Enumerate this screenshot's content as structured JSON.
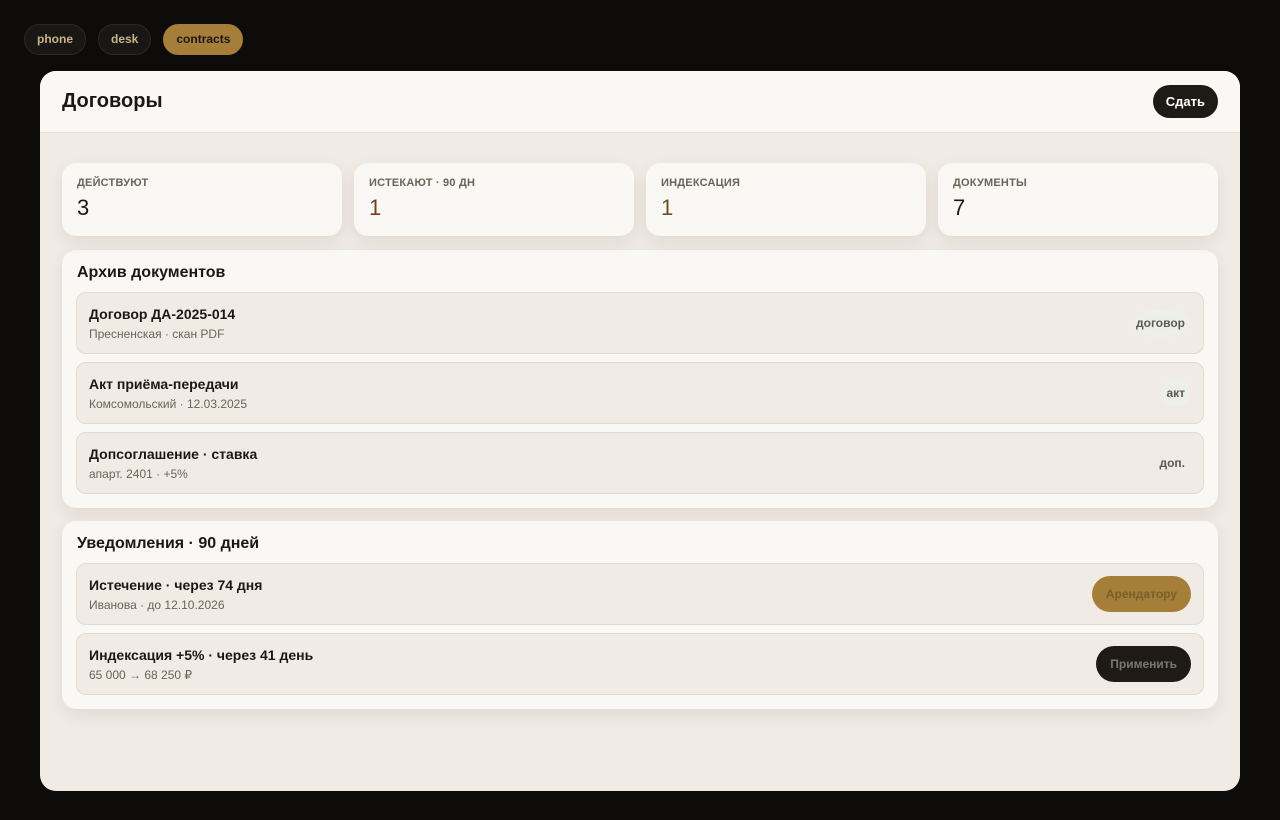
{
  "tabs": [
    {
      "label": "phone",
      "active": false
    },
    {
      "label": "desk",
      "active": false
    },
    {
      "label": "contracts",
      "active": true
    }
  ],
  "header": {
    "title": "Договоры",
    "submit_label": "Сдать"
  },
  "stats": [
    {
      "label": "ДЕЙСТВУЮТ",
      "value": "3"
    },
    {
      "label": "ИСТЕКАЮТ · 90 ДН",
      "value": "1"
    },
    {
      "label": "ИНДЕКСАЦИЯ",
      "value": "1"
    },
    {
      "label": "ДОКУМЕНТЫ",
      "value": "7"
    }
  ],
  "archive": {
    "title": "Архив документов",
    "items": [
      {
        "title": "Договор ДА-2025-014",
        "sub": "Пресненская · скан PDF",
        "tag": "договор"
      },
      {
        "title": "Акт приёма-передачи",
        "sub": "Комсомольский · 12.03.2025",
        "tag": "акт"
      },
      {
        "title": "Допсоглашение · ставка",
        "sub": "апарт. 2401 · +5%",
        "tag": "доп."
      }
    ]
  },
  "notifications": {
    "title": "Уведомления · 90 дней",
    "items": [
      {
        "title": "Истечение · через 74 дня",
        "sub": "Иванова · до 12.10.2026",
        "action": "Арендатору"
      },
      {
        "title": "Индексация +5% · через 41 день",
        "sub": "65 000 → 68 250 ₽",
        "action": "Применить"
      }
    ]
  },
  "colors": {
    "accent": "#a57e39",
    "background": "#0d0c0b",
    "surface": "#f9f8f5",
    "panel_bg": "#f0ebe5"
  }
}
